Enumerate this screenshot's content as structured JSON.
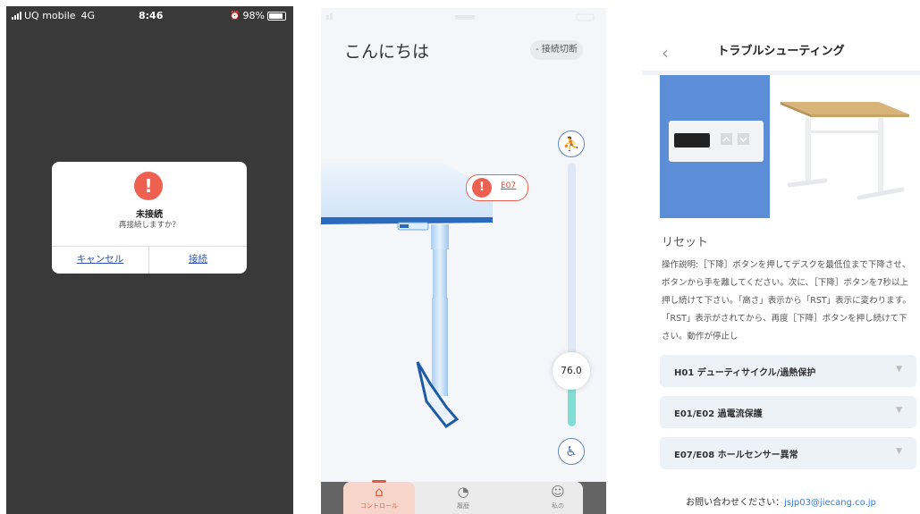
{
  "panel1": {
    "status": {
      "carrier": "UQ mobile",
      "network": "4G",
      "time": "8:46",
      "battery": "98%"
    },
    "dialog": {
      "icon": "exclamation-icon",
      "icon_glyph": "!",
      "title": "未接続",
      "message": "再接続しますか？",
      "cancel": "キャンセル",
      "connect": "接続"
    }
  },
  "panel2": {
    "greeting": "こんにちは",
    "disconnect": "- 接続切断",
    "height": "76.0",
    "height_fraction": 0.28,
    "error": {
      "icon_glyph": "!",
      "code": "E07"
    },
    "tabs": [
      {
        "label": "コントロール",
        "icon": "home-icon",
        "active": true
      },
      {
        "label": "履歴",
        "icon": "chart-icon",
        "active": false
      },
      {
        "label": "私の",
        "icon": "smile-icon",
        "active": false
      }
    ]
  },
  "panel3": {
    "title": "トラブルシューティング",
    "back": "‹",
    "section": "リセット",
    "description": "操作説明:［下降］ボタンを押してデスクを最低位まで下降させ、ボタンから手を離してください。次に、［下降］ボタンを7秒以上押し続けて下さい。「高さ」表示から「RST」表示に変わります。「RST」表示がされてから、再度［下降］ボタンを押し続けて下さい。動作が停止し",
    "faq": [
      {
        "label": "H01 デューティサイクル/過熱保护"
      },
      {
        "label": "E01/E02 過電流保護"
      },
      {
        "label": "E07/E08 ホールセンサー異常"
      }
    ],
    "contact_label": "お問い合わせください：",
    "contact_email": "jsjp03@jiecang.co.jp"
  },
  "colors": {
    "accent": "#ee6150",
    "link": "#2d56a8",
    "panel_blue": "#5b8ed6",
    "slider_fill": "#80ddd3"
  }
}
